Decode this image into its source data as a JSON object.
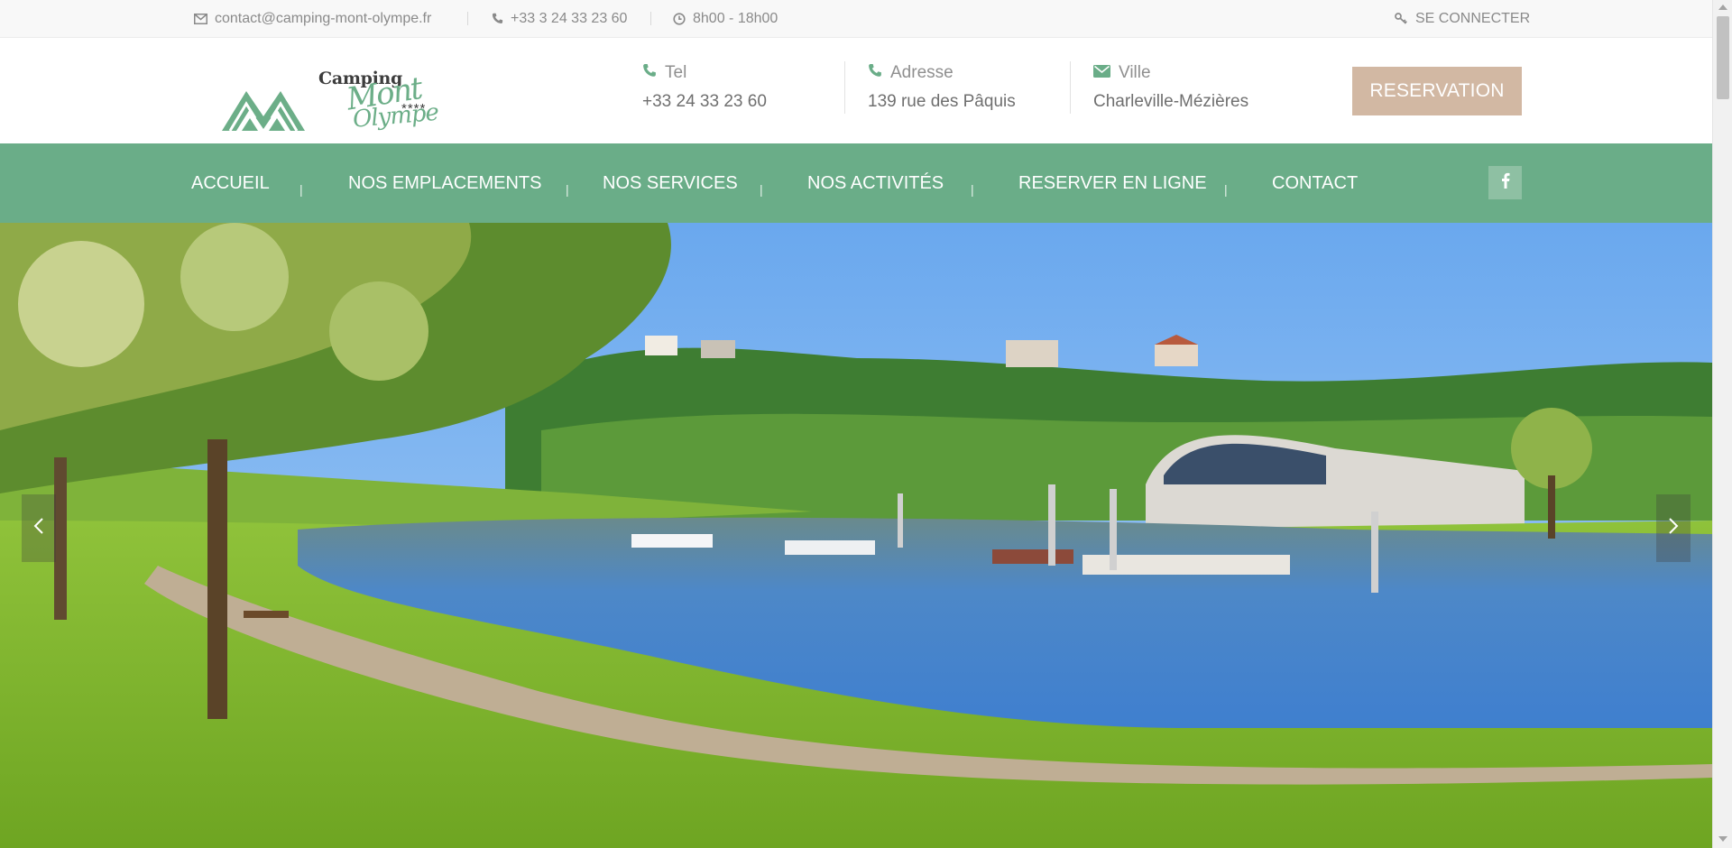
{
  "topbar": {
    "email": "contact@camping-mont-olympe.fr",
    "phone": "+33 3 24 33 23 60",
    "hours": "8h00 - 18h00",
    "login": "SE CONNECTER"
  },
  "header": {
    "logo": {
      "line1": "Camping",
      "line2": "Mont",
      "line3": "Olympe",
      "stars": "****"
    },
    "tel": {
      "label": "Tel",
      "value": "+33 24 33 23 60"
    },
    "address": {
      "label": "Adresse",
      "value": "139 rue des Pâquis"
    },
    "city": {
      "label": "Ville",
      "value": "Charleville-Mézières"
    },
    "reservation_button": "RESERVATION"
  },
  "nav": {
    "items": [
      {
        "label": "ACCUEIL"
      },
      {
        "label": "NOS EMPLACEMENTS"
      },
      {
        "label": "NOS SERVICES"
      },
      {
        "label": "NOS ACTIVITÉS"
      },
      {
        "label": "RESERVER EN LIGNE"
      },
      {
        "label": "CONTACT"
      }
    ],
    "separator": "|",
    "social_icon": "facebook-icon"
  },
  "hero": {
    "prev_icon": "chevron-left-icon",
    "next_icon": "chevron-right-icon"
  },
  "colors": {
    "brand_green": "#6aad88",
    "reservation_button": "#d2b8a3",
    "topbar_text": "#8a8a8a"
  }
}
